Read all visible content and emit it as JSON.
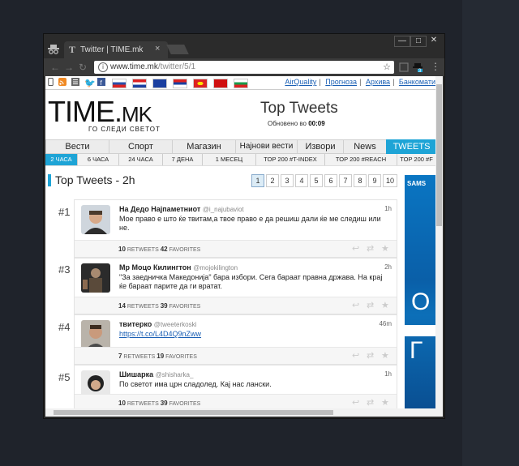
{
  "browser": {
    "tab_title": "Twitter | TIME.mk",
    "tab_favicon": "T",
    "tab_close": "×",
    "url_host": "www.time.mk",
    "url_path": "/twitter/5/1",
    "window_controls": {
      "minimize": "—",
      "maximize": "□",
      "close": "✕"
    },
    "extension_badge": "3"
  },
  "topbar": {
    "links": [
      "AirQuality",
      "Прогноза",
      "Архива",
      "Банкомати"
    ]
  },
  "site": {
    "logo_main": "TIME.",
    "logo_suffix": "MK",
    "tagline": "ГО СЛЕДИ СВЕТОТ",
    "page_title": "Top Tweets",
    "updated_label": "Обновено во",
    "updated_time": "00:09"
  },
  "main_nav": [
    "Вести",
    "Спорт",
    "Магазин",
    "Најнови вести",
    "Извори",
    "News",
    "TWEETS"
  ],
  "sub_nav": [
    "2 ЧАСА",
    "6 ЧАСА",
    "24 ЧАСА",
    "7 ДЕНА",
    "1 МЕСЕЦ",
    "TOP 200 #T-INDEX",
    "TOP 200 #REACH",
    "TOP 200 #F"
  ],
  "section": {
    "title": "Top Tweets - 2h",
    "pages": [
      "1",
      "2",
      "3",
      "4",
      "5",
      "6",
      "7",
      "8",
      "9",
      "10"
    ]
  },
  "ad": {
    "brand": "SAMS",
    "letters": [
      "О",
      "Г"
    ]
  },
  "tweets": [
    {
      "rank": "#1",
      "name": "На Дедо Најпаметниот",
      "handle": "@i_najubaviot",
      "time": "1h",
      "text": "Мое право е што ќе твитам,а твое право е да решиш дали ќе ме следиш или не.",
      "retweets": "10",
      "favorites": "42",
      "rt_label": "RETWEETS",
      "fav_label": "FAVORITES"
    },
    {
      "rank": "#3",
      "name": "Мр Моцо Килингтон",
      "handle": "@mojokilington",
      "time": "2h",
      "text": "\"За заедничка Македонија\" бара избори. Сега бараат правна држава. На крај ќе бараат парите да ги вратат.",
      "retweets": "14",
      "favorites": "39",
      "rt_label": "RETWEETS",
      "fav_label": "FAVORITES"
    },
    {
      "rank": "#4",
      "name": "твитерко",
      "handle": "@tweeterkoski",
      "time": "46m",
      "text": "https://t.co/L4D4Q9nZww",
      "retweets": "7",
      "favorites": "19",
      "rt_label": "RETWEETS",
      "fav_label": "FAVORITES"
    },
    {
      "rank": "#5",
      "name": "Шишарка",
      "handle": "@shisharka_",
      "time": "1h",
      "text": "По светот има црн сладолед. Кај нас лански.",
      "retweets": "10",
      "favorites": "39",
      "rt_label": "RETWEETS",
      "fav_label": "FAVORITES"
    }
  ]
}
